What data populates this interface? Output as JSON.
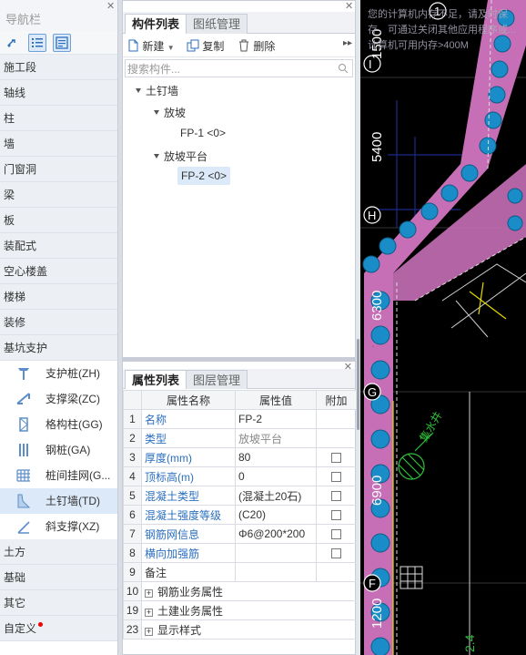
{
  "nav": {
    "title": "导航栏",
    "categories_top": [
      "施工段",
      "轴线",
      "柱",
      "墙",
      "门窗洞",
      "梁",
      "板",
      "装配式",
      "空心楼盖",
      "楼梯",
      "装修",
      "基坑支护"
    ],
    "sub_items": [
      {
        "label": "支护桩(ZH)",
        "icon": "pile-icon"
      },
      {
        "label": "支撑梁(ZC)",
        "icon": "support-beam-icon"
      },
      {
        "label": "格构柱(GG)",
        "icon": "lattice-column-icon"
      },
      {
        "label": "钢桩(GA)",
        "icon": "steel-pile-icon"
      },
      {
        "label": "桩间挂网(G...",
        "icon": "mesh-icon"
      },
      {
        "label": "土钉墙(TD)",
        "icon": "soil-nail-wall-icon"
      },
      {
        "label": "斜支撑(XZ)",
        "icon": "diagonal-brace-icon"
      }
    ],
    "categories_bottom": [
      "土方",
      "基础",
      "其它",
      "自定义"
    ]
  },
  "component_panel": {
    "tabs": [
      "构件列表",
      "图纸管理"
    ],
    "toolbar": {
      "new": "新建",
      "copy": "复制",
      "delete": "删除"
    },
    "search_placeholder": "搜索构件...",
    "tree": {
      "root": "土钉墙",
      "group1": "放坡",
      "item1": "FP-1 <0>",
      "group2": "放坡平台",
      "item2": "FP-2 <0>"
    }
  },
  "property_panel": {
    "tabs": [
      "属性列表",
      "图层管理"
    ],
    "headers": [
      "属性名称",
      "属性值",
      "附加"
    ],
    "rows": [
      {
        "n": "1",
        "name": "名称",
        "value": "FP-2",
        "style": "blue",
        "check": false
      },
      {
        "n": "2",
        "name": "类型",
        "value": "放坡平台",
        "style": "blue",
        "vstyle": "gray",
        "check": false
      },
      {
        "n": "3",
        "name": "厚度(mm)",
        "value": "80",
        "style": "blue",
        "check": true
      },
      {
        "n": "4",
        "name": "顶标高(m)",
        "value": "0",
        "style": "blue",
        "check": true
      },
      {
        "n": "5",
        "name": "混凝土类型",
        "value": "(混凝土20石)",
        "style": "blue",
        "check": true
      },
      {
        "n": "6",
        "name": "混凝土强度等级",
        "value": "(C20)",
        "style": "blue",
        "check": true
      },
      {
        "n": "7",
        "name": "钢筋网信息",
        "value": "Φ6@200*200",
        "style": "blue",
        "check": true
      },
      {
        "n": "8",
        "name": "横向加强筋",
        "value": "",
        "style": "blue",
        "check": true
      },
      {
        "n": "9",
        "name": "备注",
        "value": "",
        "style": "",
        "check": false
      },
      {
        "n": "10",
        "name": "钢筋业务属性",
        "value": "",
        "style": "",
        "check": false,
        "group": true
      },
      {
        "n": "19",
        "name": "土建业务属性",
        "value": "",
        "style": "",
        "check": false,
        "group": true
      },
      {
        "n": "23",
        "name": "显示样式",
        "value": "",
        "style": "",
        "check": false,
        "group": true
      }
    ]
  },
  "cad": {
    "axis_labels": [
      "I",
      "H",
      "G",
      "F"
    ],
    "dims": [
      "1500",
      "5400",
      "6300",
      "6900",
      "1200"
    ],
    "warning": "您的计算机内存不足，请及时保存，可通过关闭其他应用程序或... 计算机可用内存>400M",
    "annotation": "集水井",
    "misc": "2.4",
    "axis_top": "1"
  },
  "colors": {
    "accent": "#2b6fbf",
    "selected": "#dce9f8",
    "wall": "#c66fb6",
    "dot": "#1a8cc8"
  }
}
